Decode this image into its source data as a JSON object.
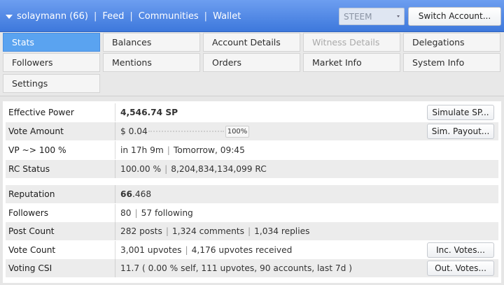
{
  "header": {
    "user": "solaymann (66)",
    "nav": [
      "Feed",
      "Communities",
      "Wallet"
    ],
    "chain": "STEEM",
    "switch_label": "Switch Account..."
  },
  "tabs": [
    {
      "label": "Stats",
      "state": "active"
    },
    {
      "label": "Balances"
    },
    {
      "label": "Account Details"
    },
    {
      "label": "Witness Details",
      "state": "disabled"
    },
    {
      "label": "Delegations"
    },
    {
      "label": "Followers"
    },
    {
      "label": "Mentions"
    },
    {
      "label": "Orders"
    },
    {
      "label": "Market Info"
    },
    {
      "label": "System Info"
    },
    {
      "label": "Settings"
    }
  ],
  "stats": {
    "effective_power": {
      "label": "Effective Power",
      "value": "4,546.74 SP",
      "button": "Simulate SP..."
    },
    "vote_amount": {
      "label": "Vote Amount",
      "value": "$ 0.04",
      "slider_pct": "100%",
      "button": "Sim. Payout..."
    },
    "vp": {
      "label": "VP ~> 100 %",
      "time": "in 17h 9m",
      "date": "Tomorrow, 09:45"
    },
    "rc": {
      "label": "RC Status",
      "pct": "100.00 %",
      "amount": "8,204,834,134,099 RC"
    },
    "reputation": {
      "label": "Reputation",
      "int": "66",
      "dec": ".468"
    },
    "followers": {
      "label": "Followers",
      "count": "80",
      "following": "57 following"
    },
    "post_count": {
      "label": "Post Count",
      "posts": "282 posts",
      "comments": "1,324 comments",
      "replies": "1,034 replies"
    },
    "vote_count": {
      "label": "Vote Count",
      "upvotes": "3,001 upvotes",
      "received": "4,176 upvotes received",
      "button": "Inc. Votes..."
    },
    "voting_csi": {
      "label": "Voting CSI",
      "value": "11.7 ( 0.00 % self, 111 upvotes, 90 accounts, last 7d )",
      "button": "Out. Votes..."
    }
  }
}
